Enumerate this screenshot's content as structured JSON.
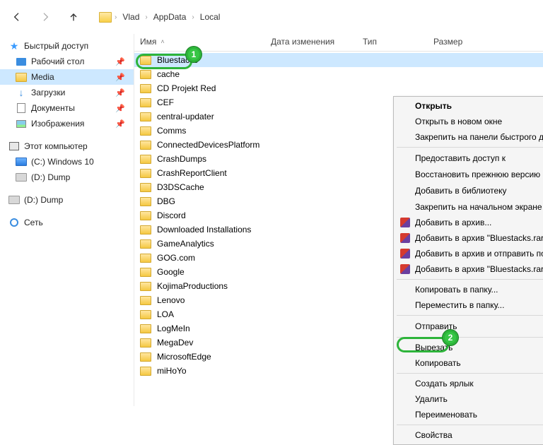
{
  "breadcrumb": {
    "p1": "Vlad",
    "p2": "AppData",
    "p3": "Local"
  },
  "sidebar": {
    "quick": "Быстрый доступ",
    "desktop": "Рабочий стол",
    "media": "Media",
    "downloads": "Загрузки",
    "documents": "Документы",
    "pictures": "Изображения",
    "thispc": "Этот компьютер",
    "diskC": "(C:) Windows 10",
    "diskD1": "(D:) Dump",
    "diskD2": "(D:) Dump",
    "network": "Сеть"
  },
  "columns": {
    "name": "Имя",
    "date": "Дата изменения",
    "type": "Тип",
    "size": "Размер"
  },
  "files": {
    "f0": "Bluestacks",
    "f1": "cache",
    "f2": "CD Projekt Red",
    "f3": "CEF",
    "f4": "central-updater",
    "f5": "Comms",
    "f6": "ConnectedDevicesPlatform",
    "f7": "CrashDumps",
    "f8": "CrashReportClient",
    "f9": "D3DSCache",
    "f10": "DBG",
    "f11": "Discord",
    "f12": "Downloaded Installations",
    "f13": "GameAnalytics",
    "f14": "GOG.com",
    "f15": "Google",
    "f16": "KojimaProductions",
    "f17": "Lenovo",
    "f18": "LOA",
    "f19": "LogMeIn",
    "f20": "MegaDev",
    "f21": "MicrosoftEdge",
    "f22": "miHoYo"
  },
  "menu": {
    "open": "Открыть",
    "openNew": "Открыть в новом окне",
    "pinQuick": "Закрепить на панели быстрого доступа",
    "giveAccess": "Предоставить доступ к",
    "restore": "Восстановить прежнюю версию",
    "addLib": "Добавить в библиотеку",
    "pinStart": "Закрепить на начальном экране",
    "addArchive": "Добавить в архив...",
    "addArchiveName": "Добавить в архив \"Bluestacks.rar\"",
    "addEmail": "Добавить в архив и отправить по e-mail...",
    "addNameEmail": "Добавить в архив \"Bluestacks.rar\" и отправить по e-mail",
    "copyFolder": "Копировать в папку...",
    "moveFolder": "Переместить в папку...",
    "send": "Отправить",
    "cut": "Вырезать",
    "copy": "Копировать",
    "shortcut": "Создать ярлык",
    "delete": "Удалить",
    "rename": "Переименовать",
    "props": "Свойства"
  },
  "badges": {
    "b1": "1",
    "b2": "2"
  }
}
